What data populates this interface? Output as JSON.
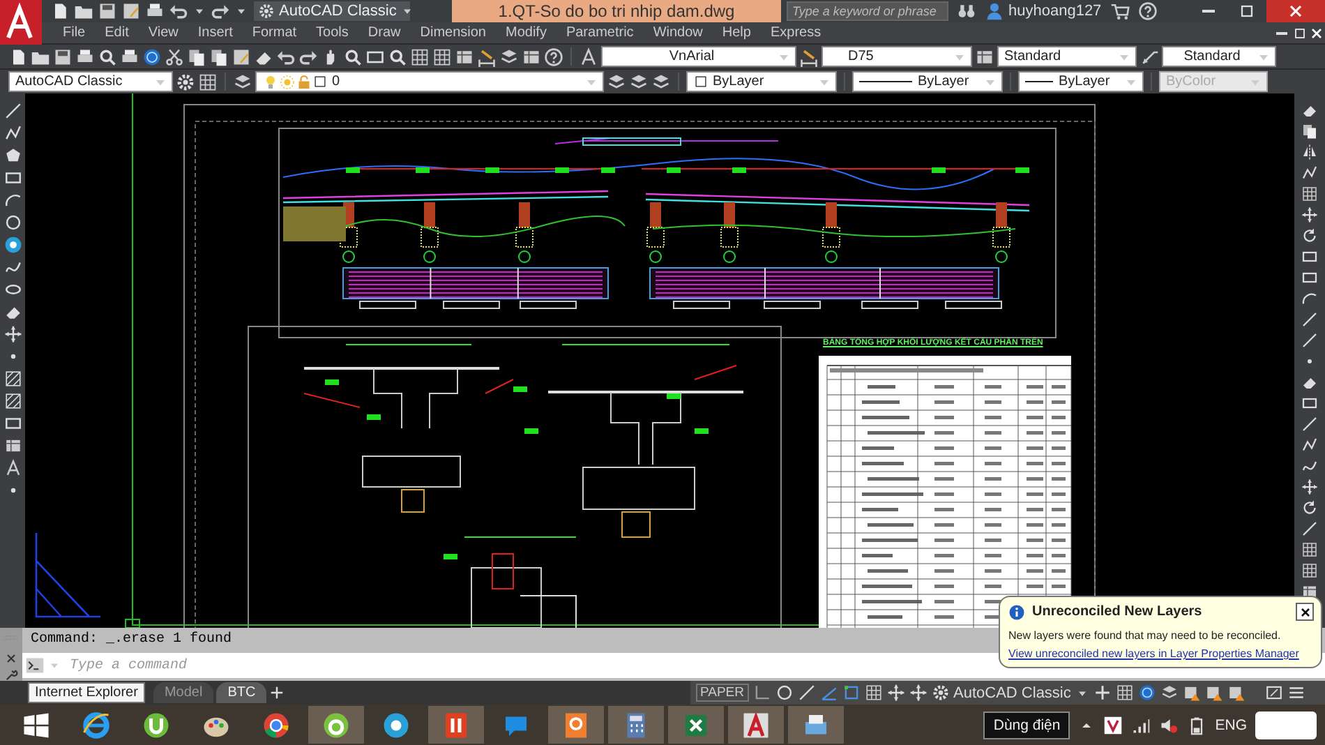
{
  "title_bar": {
    "workspace": "AutoCAD Classic",
    "document_title": "1.QT-So do bo tri nhip dam.dwg",
    "search": {
      "placeholder": "Type a keyword or phrase"
    },
    "user": "huyhoang127"
  },
  "menu_bar": {
    "items": [
      "File",
      "Edit",
      "View",
      "Insert",
      "Format",
      "Tools",
      "Draw",
      "Dimension",
      "Modify",
      "Parametric",
      "Window",
      "Help",
      "Express"
    ]
  },
  "styles_toolbar": {
    "text_style": "VnArial",
    "dim_style": "D75",
    "table_style": "Standard",
    "multileader_style": "Standard"
  },
  "properties_toolbar": {
    "workspace": "AutoCAD Classic",
    "layer": "0",
    "fields": [
      {
        "kind": "swatch",
        "value": "ByLayer"
      },
      {
        "kind": "line",
        "value": "ByLayer"
      },
      {
        "kind": "line",
        "value": "ByLayer"
      }
    ],
    "plot_style": {
      "value": "ByColor",
      "disabled": true
    }
  },
  "drawing": {
    "table_title": "BẢNG TỔNG HỢP KHỐI LƯỢNG KẾT CẤU PHẦN TRÊN"
  },
  "command_line": {
    "history": "Command: _.erase 1 found",
    "placeholder": "Type a command"
  },
  "layout_tabs": [
    {
      "label": "Model",
      "selected": false
    },
    {
      "label": "BTC",
      "selected": true
    }
  ],
  "status_bar": {
    "space": "PAPER",
    "workspace": "AutoCAD Classic"
  },
  "notification": {
    "title": "Unreconciled New Layers",
    "message": "New layers were found that may need to be reconciled.",
    "link": "View unreconciled new layers in Layer Properties Manager"
  },
  "tooltip": "Internet Explorer",
  "taskbar": {
    "tooltip": "Dùng điện",
    "language": "ENG"
  }
}
